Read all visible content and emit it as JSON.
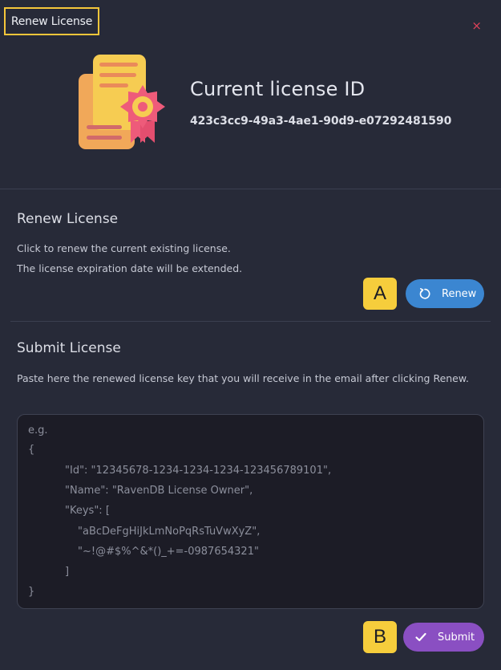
{
  "dialog": {
    "title": "Renew License",
    "close_symbol": "×"
  },
  "current_license": {
    "heading": "Current license ID",
    "id": "423c3cc9-49a3-4ae1-90d9-e07292481590",
    "icon": "license-certificate-icon"
  },
  "renew_section": {
    "title": "Renew License",
    "line1": "Click to renew the current existing license.",
    "line2": "The license expiration date will be extended.",
    "badge": "A",
    "button_label": "Renew",
    "button_icon": "refresh-icon"
  },
  "submit_section": {
    "title": "Submit License",
    "description": "Paste here the renewed license key that you will receive in the email after clicking Renew.",
    "placeholder": [
      "e.g.",
      "{",
      "\"Id\": \"12345678-1234-1234-1234-123456789101\",",
      "\"Name\": \"RavenDB License Owner\",",
      "\"Keys\": [",
      "\"aBcDeFgHiJkLmNoPqRsTuVwXyZ\",",
      "\"~!@#$%^&*()_+=-0987654321\"",
      "]",
      "}"
    ],
    "badge": "B",
    "button_label": "Submit",
    "button_icon": "check-icon"
  },
  "colors": {
    "background": "#272a38",
    "title_highlight": "#f5c63a",
    "close": "#e0425a",
    "renew_button": "#3b86d1",
    "submit_button": "#8a4fc2",
    "badge": "#f6cd3c"
  }
}
